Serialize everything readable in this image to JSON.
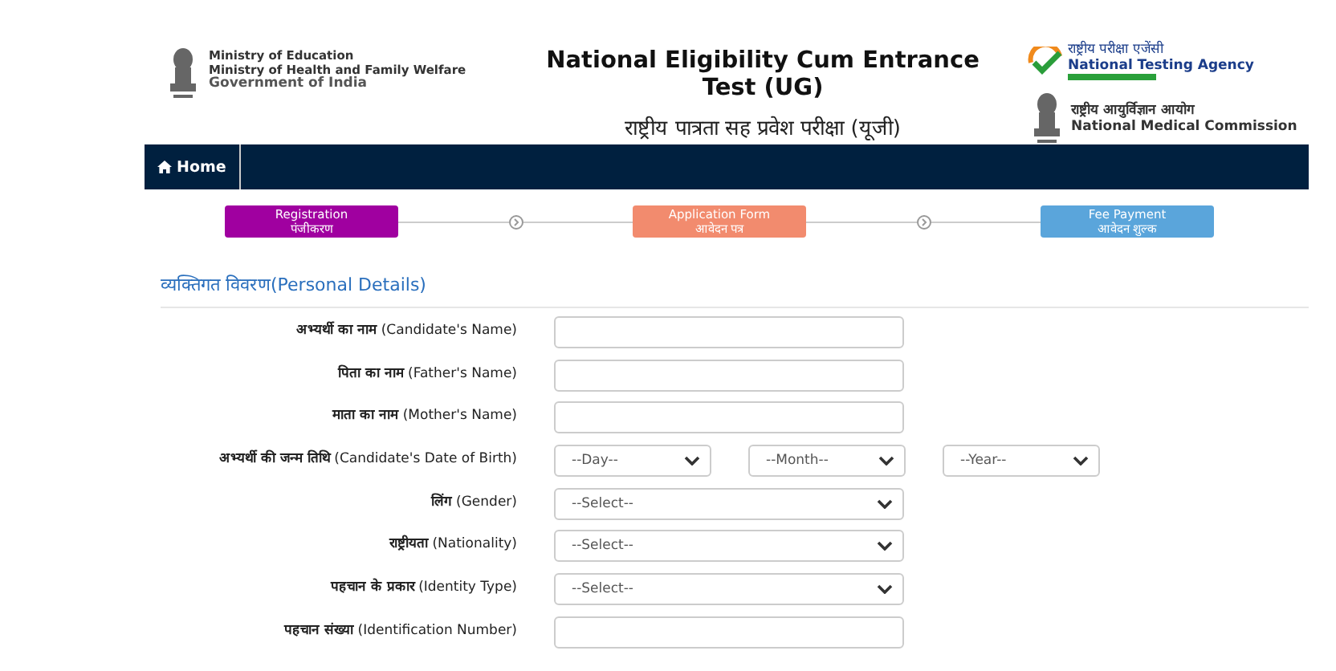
{
  "header": {
    "ministry_lines": [
      "Ministry of Education",
      "Ministry of Health and Family Welfare",
      "Government of India"
    ],
    "title": "National Eligibility Cum Entrance Test (UG)",
    "subtitle": "राष्ट्रीय पात्रता सह प्रवेश परीक्षा (यूजी)",
    "nta": {
      "hindi": "राष्ट्रीय परीक्षा एजेंसी",
      "english": "National Testing Agency"
    },
    "nmc": {
      "hindi": "राष्ट्रीय आयुर्विज्ञान आयोग",
      "english": "National Medical Commission"
    }
  },
  "nav": {
    "items": [
      {
        "label": "Home"
      }
    ]
  },
  "steps": [
    {
      "label": "Registration",
      "hindi": "पंजीकरण",
      "color": "#a000a0"
    },
    {
      "label": "Application Form",
      "hindi": "आवेदन पत्र",
      "color": "#f28b6e"
    },
    {
      "label": "Fee Payment",
      "hindi": "आवेदन शुल्क",
      "color": "#5aa5db"
    }
  ],
  "section": {
    "title": "व्यक्तिगत विवरण(Personal Details)"
  },
  "fields": [
    {
      "kind": "text",
      "label": "अभ्यर्थी का नाम",
      "label_en": "(Candidate's Name)"
    },
    {
      "kind": "text",
      "label": "पिता का नाम",
      "label_en": "(Father's Name)"
    },
    {
      "kind": "text",
      "label": "माता का नाम",
      "label_en": "(Mother's Name)"
    },
    {
      "kind": "date",
      "label": "अभ्यर्थी की जन्म तिथि",
      "label_en": "(Candidate's Date of Birth)",
      "options": [
        "--Day--",
        "--Month--",
        "--Year--"
      ]
    },
    {
      "kind": "select",
      "label": "लिंग",
      "label_en": "(Gender)",
      "value": "--Select--"
    },
    {
      "kind": "select",
      "label": "राष्ट्रीयता",
      "label_en": "(Nationality)",
      "value": "--Select--"
    },
    {
      "kind": "select",
      "label": "पहचान के प्रकार",
      "label_en": "(Identity Type)",
      "value": "--Select--"
    },
    {
      "kind": "text",
      "label": "पहचान संख्या",
      "label_en": "(Identification Number)"
    }
  ]
}
